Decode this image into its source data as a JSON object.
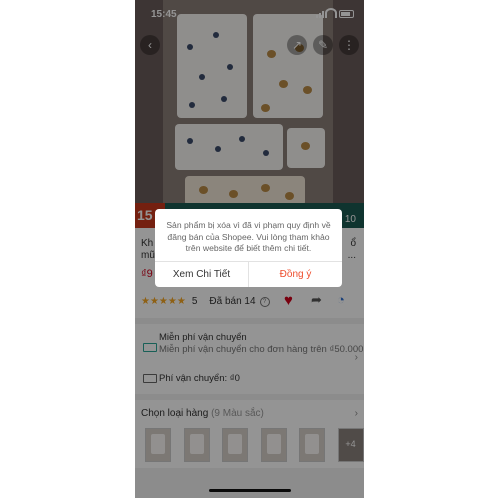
{
  "status_bar": {
    "time": "15:45"
  },
  "product": {
    "promo_badge": "15",
    "title_start": "Kh",
    "title_start_line2": "mũ",
    "title_right_line1": "ổ",
    "title_right_line2": "...",
    "sku_suffix": "10",
    "price_partial": "₫9",
    "rating_stars": "★★★★★",
    "rating_value": "5",
    "sold_text": "Đã bán 14",
    "help_icon_glyph": "?"
  },
  "shipping": {
    "free_label": "Miễn phí vận chuyển",
    "free_detail": "Miễn phí vận chuyển cho đơn hàng trên ₫50.000",
    "fee_label": "Phí vận chuyển: ₫0"
  },
  "variants": {
    "heading": "Chọn loại hàng",
    "count_text": "(9 Màu sắc)",
    "more_label": "+4",
    "thumbnail_count": 6
  },
  "dialog": {
    "message": "Sản phẩm bị xóa vì đã vi phạm quy định về đăng bán của Shopee. Vui lòng tham khảo trên website để biết thêm chi tiết.",
    "details_button": "Xem Chi Tiết",
    "agree_button": "Đồng ý"
  },
  "icons": {
    "back": "back-icon",
    "share_top": "share-icon",
    "edit": "edit-icon",
    "more": "more-icon",
    "favorite": "heart-icon",
    "share": "share-icon",
    "chat": "chat-icon",
    "truck": "truck-icon",
    "chevron": "chevron-right-icon"
  },
  "colors": {
    "accent": "#ee4d2d",
    "price": "#d0011b",
    "star": "#f4a623",
    "overlay": "rgba(0,0,0,0.42)"
  }
}
